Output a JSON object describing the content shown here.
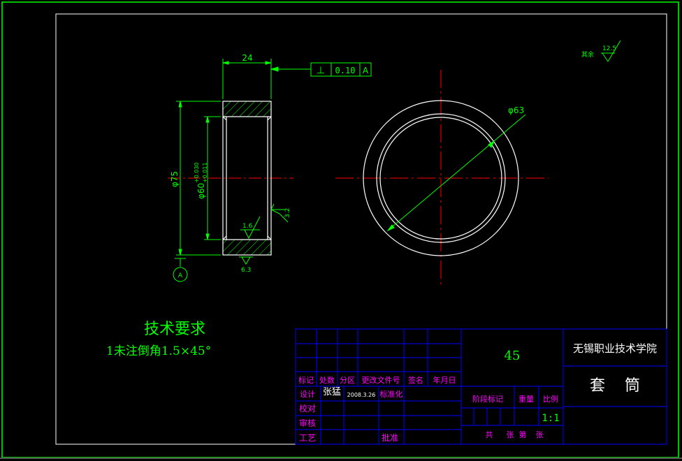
{
  "dimensions": {
    "width_24": "24",
    "dia_75": "φ75",
    "dia_60": "φ60",
    "tol_upper": "+0.030",
    "tol_lower": "+0.011",
    "dia_63": "φ63"
  },
  "tolerance_frame": {
    "symbol": "⊥",
    "value": "0.10",
    "datum": "A"
  },
  "datum_marker": "A",
  "roughness": {
    "r_32": "3.2",
    "r_16": "1.6",
    "r_63": "6.3",
    "rest_label": "其余",
    "rest_value": "12.5"
  },
  "tech_req": {
    "title": "技术要求",
    "item1": "1未注倒角1.5×45°"
  },
  "title_block": {
    "material": "45",
    "institution": "无锡职业技术学院",
    "part_name": "套    筒",
    "header_labels": {
      "mark": "标记",
      "count": "处数",
      "zone": "分区",
      "doc_no": "更改文件号",
      "sign": "签名",
      "date": "年月日"
    },
    "row_design": {
      "label": "设计",
      "name": "张猛",
      "date": "2008.3.26",
      "std": "标准化"
    },
    "check_label": "校对",
    "review_label": "审核",
    "process_label": "工艺",
    "approve_label": "批准",
    "stage_label": "阶段标记",
    "weight_label": "重量",
    "scale_label": "比例",
    "scale_value": "1:1",
    "sheets_total": "共",
    "sheets_zhang1": "张",
    "sheets_di": "第",
    "sheets_zhang2": "张"
  },
  "colors": {
    "frame": "#00ff00",
    "geometry": "#ffffff",
    "centerline": "#ff0000",
    "title_lines": "#0000ff",
    "label_text": "#ff00ff",
    "hatch": "#00ff00"
  }
}
